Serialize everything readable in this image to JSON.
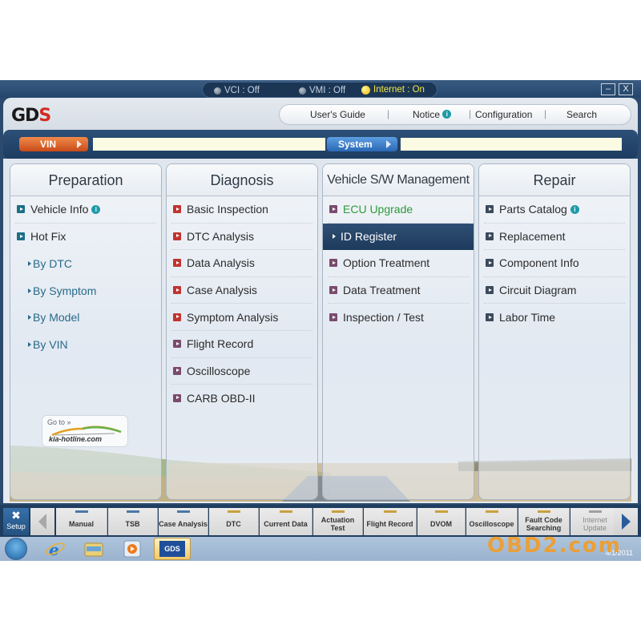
{
  "titlebar": {
    "status": [
      {
        "label": "VCI : Off",
        "state": "off"
      },
      {
        "label": "VMI : Off",
        "state": "off"
      },
      {
        "label": "Internet : On",
        "state": "on"
      }
    ],
    "minimize": "–",
    "close": "X"
  },
  "header": {
    "logo": "GD",
    "logo_accent": "S",
    "nav": {
      "users_guide": "User's Guide",
      "notice": "Notice",
      "configuration": "Configuration",
      "search": "Search"
    }
  },
  "searchbar": {
    "vin_label": "VIN",
    "vin_value": "",
    "system_label": "System",
    "system_value": ""
  },
  "panels": {
    "preparation": {
      "title": "Preparation",
      "items": [
        "Vehicle Info",
        "Hot Fix"
      ],
      "sub_items": [
        "By DTC",
        "By Symptom",
        "By Model",
        "By VIN"
      ]
    },
    "diagnosis": {
      "title": "Diagnosis",
      "items": [
        "Basic Inspection",
        "DTC Analysis",
        "Data Analysis",
        "Case Analysis",
        "Symptom Analysis",
        "Flight Record",
        "Oscilloscope",
        "CARB OBD-II"
      ]
    },
    "vehicle_sw": {
      "title": "Vehicle S/W Management",
      "items": [
        "ECU Upgrade",
        "ID Register",
        "Option Treatment",
        "Data Treatment",
        "Inspection / Test"
      ],
      "selected": "ID Register"
    },
    "repair": {
      "title": "Repair",
      "items": [
        "Parts Catalog",
        "Replacement",
        "Component Info",
        "Circuit Diagram",
        "Labor Time"
      ]
    }
  },
  "kia_link": {
    "goto": "Go to »",
    "url": "kia-hotline.com"
  },
  "quickbar": {
    "setup": "Setup",
    "tabs": [
      {
        "label": "Manual",
        "color": "#4a78a8"
      },
      {
        "label": "TSB",
        "color": "#4a78a8"
      },
      {
        "label": "Case Analysis",
        "color": "#4a78a8"
      },
      {
        "label": "DTC",
        "color": "#c8a040"
      },
      {
        "label": "Current Data",
        "color": "#c8a040"
      },
      {
        "label": "Actuation Test",
        "color": "#c8a040"
      },
      {
        "label": "Flight Record",
        "color": "#c8a040"
      },
      {
        "label": "DVOM",
        "color": "#c8a040"
      },
      {
        "label": "Oscilloscope",
        "color": "#c8a040"
      },
      {
        "label": "Fault Code Searching",
        "color": "#c8a040"
      },
      {
        "label": "Internet Update",
        "color": "#a0a0a0"
      }
    ]
  },
  "taskbar": {
    "gds_label": "GDS",
    "date": "4/1/2011",
    "watermark": "OBD2.com"
  }
}
